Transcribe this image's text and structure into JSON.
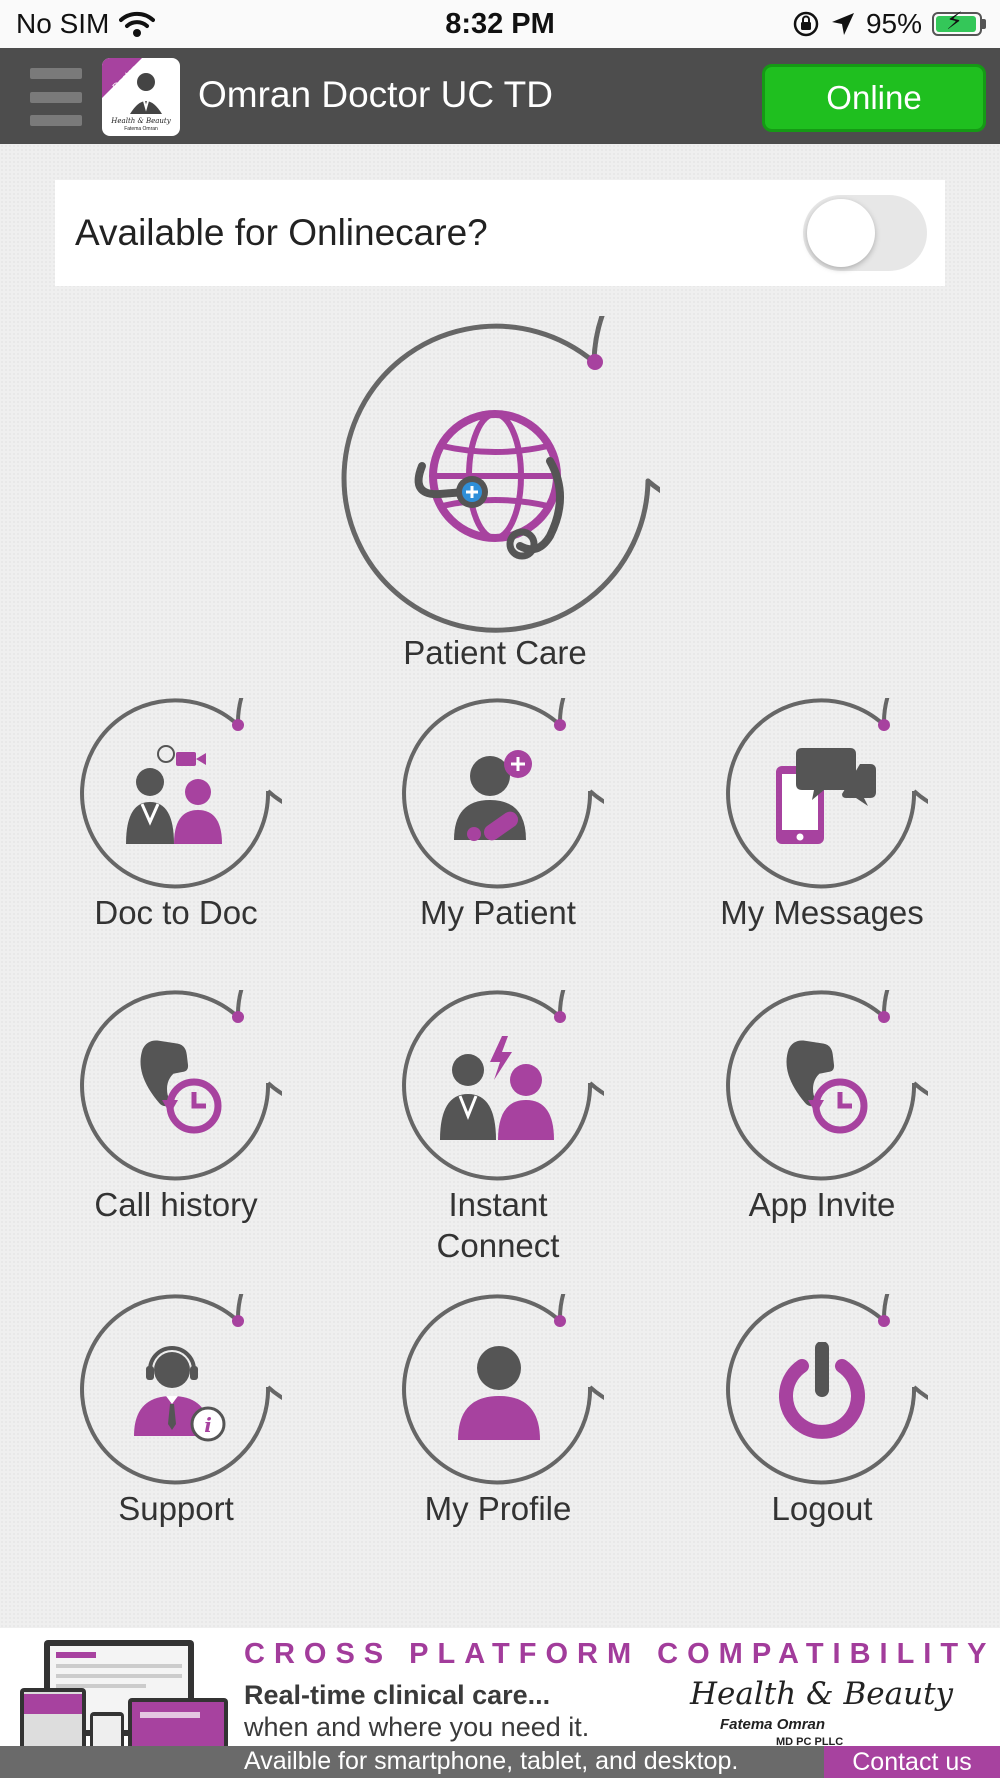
{
  "status_bar": {
    "carrier": "No SIM",
    "time": "8:32 PM",
    "battery": "95%",
    "battery_level": 0.95
  },
  "header": {
    "title": "Omran Doctor UC TD",
    "status_button": "Online",
    "logo_badge": "Doctor",
    "logo_brand": "Health & Beauty",
    "logo_name": "Fatema Omran",
    "status_color": "#1fbf1f"
  },
  "availability": {
    "label": "Available for Onlinecare?",
    "enabled": false
  },
  "tiles": {
    "patient_care": "Patient Care",
    "doc_to_doc": "Doc to Doc",
    "my_patient": "My Patient",
    "my_messages": "My Messages",
    "call_history": "Call history",
    "instant_connect_line1": "Instant",
    "instant_connect_line2": "Connect",
    "app_invite": "App Invite",
    "support": "Support",
    "my_profile": "My Profile",
    "logout": "Logout"
  },
  "banner": {
    "headline": "CROSS PLATFORM COMPATIBILITY",
    "line1": "Real-time clinical care...",
    "line2": "when and where you need it.",
    "brand": "Health & Beauty",
    "owner": "Fatema Omran",
    "credentials": "MD PC PLLC",
    "availability": "Availble for smartphone, tablet, and desktop.",
    "contact": "Contact us"
  },
  "colors": {
    "accent": "#a7429f",
    "header_bg": "#4d4d4d",
    "icon_gray": "#555555",
    "online_green": "#1fbf1f"
  },
  "icons": {
    "patient_care": "globe-stethoscope-icon",
    "doc_to_doc": "doctors-video-icon",
    "my_patient": "patient-pill-icon",
    "my_messages": "phone-chat-icon",
    "call_history": "phone-clock-icon",
    "instant_connect": "doctor-patient-lightning-icon",
    "app_invite": "phone-clock-icon",
    "support": "headset-agent-icon",
    "my_profile": "user-icon",
    "logout": "power-icon"
  }
}
